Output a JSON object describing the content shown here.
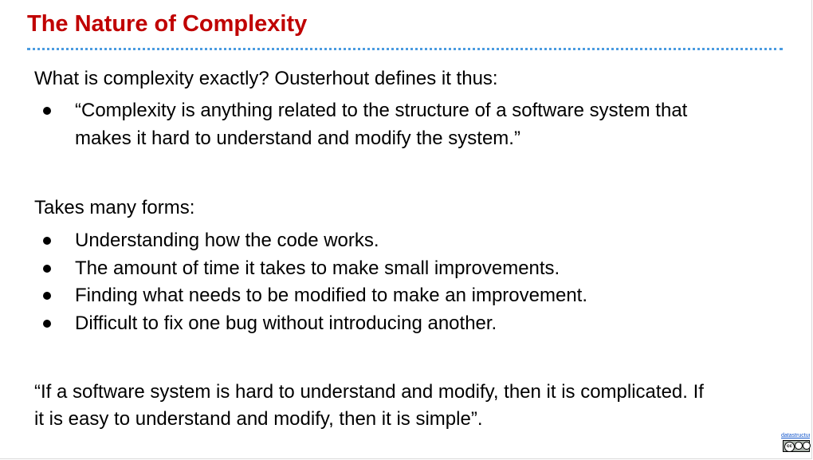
{
  "slide": {
    "title": "The Nature of Complexity",
    "intro": "What is complexity exactly? Ousterhout defines it thus:",
    "definition_bullets": [
      {
        "line1": "“Complexity is anything related to the structure of a software system that",
        "line2": "makes it hard to understand and modify the system.”"
      }
    ],
    "forms_heading": "Takes many forms:",
    "forms_bullets": [
      "Understanding how the code works.",
      "The amount of time it takes to make small improvements.",
      "Finding what needs to be modified to make an improvement.",
      "Difficult to fix one bug without introducing another."
    ],
    "closing_quote": {
      "line1": "“If a software system is hard to understand and modify, then it is complicated. If",
      "line2": "it is easy to understand and modify, then it is simple”."
    },
    "license_link": "datastructur.es",
    "license_badge_icon": "cc-by-nc-sa-icon"
  },
  "colors": {
    "title": "#c00000",
    "title_rule": "#4a9be0",
    "text": "#000000"
  }
}
